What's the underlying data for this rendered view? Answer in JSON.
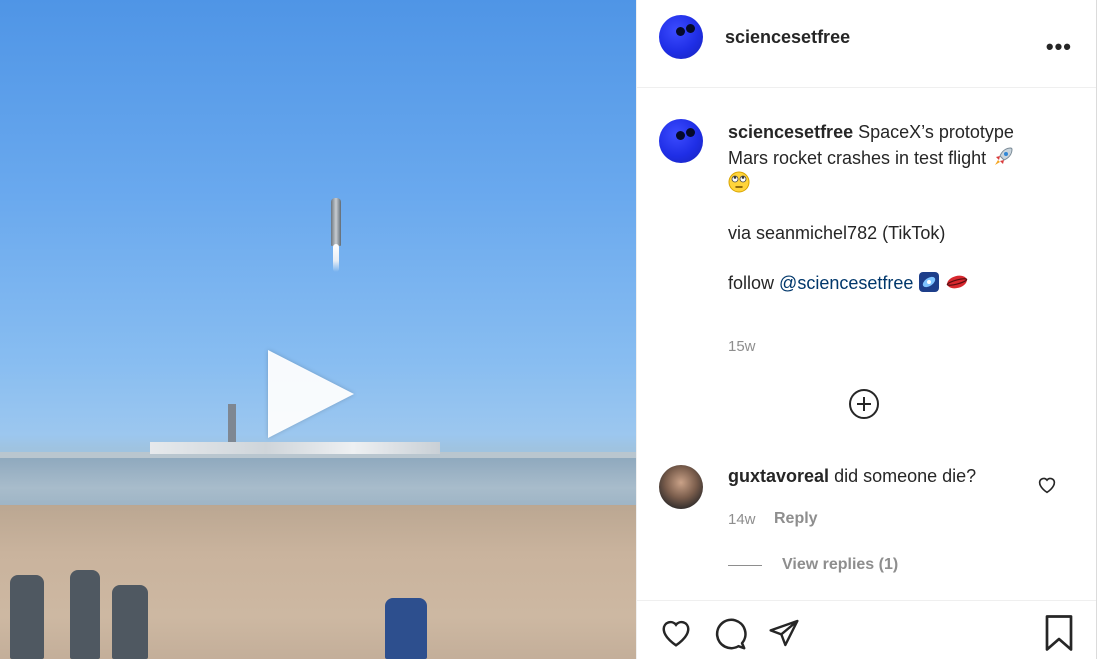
{
  "post": {
    "username": "sciencesetfree",
    "more_label": "•••"
  },
  "caption": {
    "username": "sciencesetfree",
    "line1": "SpaceX’s prototype Mars rocket crashes in test flight",
    "line2": "via seanmichel782 (TikTok)",
    "line3_prefix": "follow",
    "mention": "@sciencesetfree",
    "time": "15w",
    "icons": [
      "rocket-emoji",
      "rolling-eyes-emoji",
      "galaxy-emoji",
      "red-planet-emoji"
    ]
  },
  "comments": [
    {
      "username": "guxtavoreal",
      "text": "did someone die?",
      "time": "14w",
      "reply_label": "Reply",
      "view_replies": "View replies (1)"
    }
  ],
  "colors": {
    "text": "#262626",
    "muted": "#8e8e8e",
    "mention": "#00376b",
    "avatar_blue": "#1f2ee6"
  }
}
